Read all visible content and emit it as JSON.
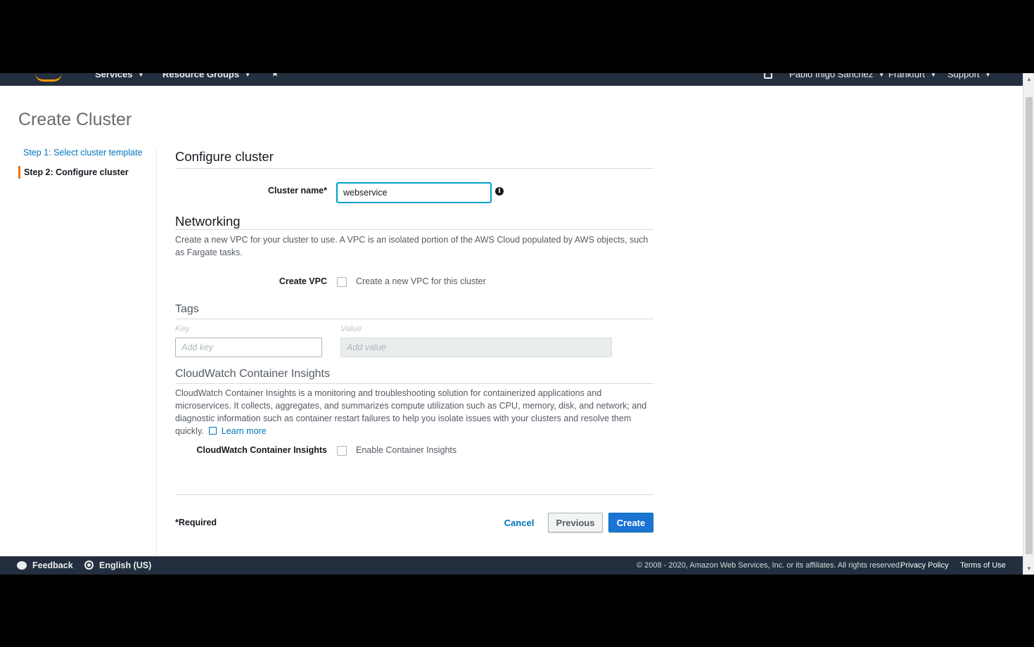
{
  "nav": {
    "services": "Services",
    "resource_groups": "Resource Groups",
    "pin_glyph": "★",
    "user": "Pablo Iñigo Sánchez",
    "region": "Frankfurt",
    "support": "Support"
  },
  "page": {
    "title": "Create Cluster"
  },
  "steps": [
    {
      "label": "Step 1: Select cluster template"
    },
    {
      "label": "Step 2: Configure cluster"
    }
  ],
  "configure": {
    "title": "Configure cluster",
    "cluster_name_label": "Cluster name*",
    "cluster_name_value": "webservice",
    "info_glyph": "i"
  },
  "networking": {
    "title": "Networking",
    "description": "Create a new VPC for your cluster to use. A VPC is an isolated portion of the AWS Cloud populated by AWS objects, such as Fargate tasks.",
    "create_vpc_label": "Create VPC",
    "create_vpc_checkbox_label": "Create a new VPC for this cluster"
  },
  "tags": {
    "title": "Tags",
    "key_header": "Key",
    "value_header": "Value",
    "key_placeholder": "Add key",
    "value_placeholder": "Add value"
  },
  "insights": {
    "title": "CloudWatch Container Insights",
    "description": "CloudWatch Container Insights is a monitoring and troubleshooting solution for containerized applications and microservices. It collects, aggregates, and summarizes compute utilization such as CPU, memory, disk, and network; and diagnostic information such as container restart failures to help you isolate issues with your clusters and resolve them quickly.",
    "learn_more": "Learn more",
    "field_label": "CloudWatch Container Insights",
    "checkbox_label": "Enable Container Insights"
  },
  "actions": {
    "required_note": "*Required",
    "cancel": "Cancel",
    "previous": "Previous",
    "create": "Create"
  },
  "footer": {
    "feedback": "Feedback",
    "language": "English (US)",
    "copyright": "© 2008 - 2020, Amazon Web Services, Inc. or its affiliates. All rights reserved.",
    "privacy": "Privacy Policy",
    "terms": "Terms of Use"
  },
  "colors": {
    "nav_bg": "#232f3e",
    "accent_orange": "#ec7211",
    "link_blue": "#0073bb",
    "primary_button": "#1b74d4"
  }
}
